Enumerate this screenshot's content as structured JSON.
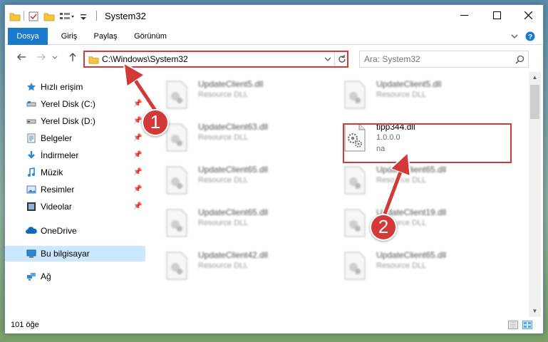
{
  "window": {
    "title": "System32"
  },
  "ribbon": {
    "tabs": [
      {
        "label": "Dosya"
      },
      {
        "label": "Giriş"
      },
      {
        "label": "Paylaş"
      },
      {
        "label": "Görünüm"
      }
    ]
  },
  "address": {
    "path": "C:\\Windows\\System32",
    "search_placeholder": "Ara: System32"
  },
  "nav": {
    "items": [
      {
        "label": "Hızlı erişim",
        "icon": "star-icon"
      },
      {
        "label": "Yerel Disk (C:)",
        "icon": "drive-icon",
        "pinned": true
      },
      {
        "label": "Yerel Disk (D:)",
        "icon": "drive-icon",
        "pinned": true
      },
      {
        "label": "Belgeler",
        "icon": "documents-icon",
        "pinned": true
      },
      {
        "label": "İndirmeler",
        "icon": "download-icon",
        "pinned": true
      },
      {
        "label": "Müzik",
        "icon": "music-icon",
        "pinned": true
      },
      {
        "label": "Resimler",
        "icon": "pictures-icon",
        "pinned": true
      },
      {
        "label": "Videolar",
        "icon": "videos-icon",
        "pinned": true
      },
      {
        "label": "OneDrive",
        "icon": "cloud-icon"
      },
      {
        "label": "Bu bilgisayar",
        "icon": "computer-icon",
        "selected": true
      },
      {
        "label": "Ağ",
        "icon": "network-icon"
      }
    ]
  },
  "files": {
    "left": [
      {
        "name": "UpdateClient5.dll",
        "type": "Resource DLL"
      },
      {
        "name": "UpdateClient63.dll",
        "type": "Resource DLL"
      },
      {
        "name": "UpdateClient65.dll",
        "type": "Resource DLL"
      },
      {
        "name": "UpdateClient65.dll",
        "type": "Resource DLL"
      },
      {
        "name": "UpdateClient42.dll",
        "type": "Resource DLL"
      }
    ],
    "right": [
      {
        "name": "UpdateClient5.dll",
        "type": "Resource DLL"
      },
      {
        "name": "UpdateClient65.dll",
        "type": "Resource DLL"
      },
      {
        "name": "UpdateClient19.dll",
        "type": "Resource DLL"
      },
      {
        "name": "UpdateClient65.dll",
        "type": "Resource DLL"
      }
    ],
    "highlighted": {
      "name": "tipp344.dll",
      "version": "1.0.0.0",
      "company": "na"
    }
  },
  "status": {
    "count": "101 öğe"
  },
  "annotations": {
    "step1": "1",
    "step2": "2",
    "color": "#d23a3a"
  }
}
